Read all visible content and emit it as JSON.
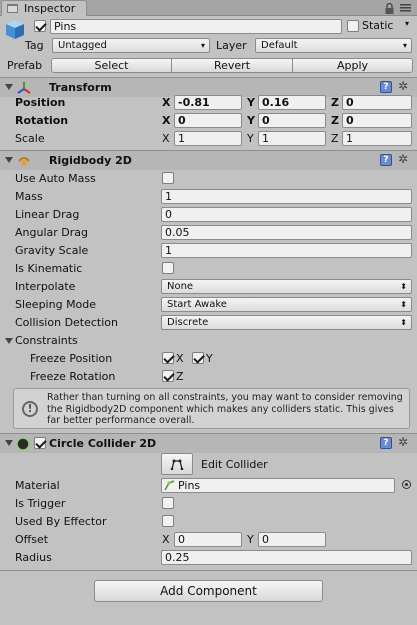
{
  "window": {
    "tab_label": "Inspector"
  },
  "gameobject": {
    "name": "Pins",
    "static_label": "Static",
    "tag_label": "Tag",
    "tag_value": "Untagged",
    "layer_label": "Layer",
    "layer_value": "Default",
    "prefab_label": "Prefab",
    "prefab_buttons": [
      "Select",
      "Revert",
      "Apply"
    ]
  },
  "transform": {
    "title": "Transform",
    "position_label": "Position",
    "position": {
      "x": "-0.81",
      "y": "0.16",
      "z": "0"
    },
    "rotation_label": "Rotation",
    "rotation": {
      "x": "0",
      "y": "0",
      "z": "0"
    },
    "scale_label": "Scale",
    "scale": {
      "x": "1",
      "y": "1",
      "z": "1"
    }
  },
  "axis": {
    "x": "X",
    "y": "Y",
    "z": "Z"
  },
  "rigidbody": {
    "title": "Rigidbody 2D",
    "use_auto_mass_label": "Use Auto Mass",
    "mass_label": "Mass",
    "mass": "1",
    "linear_drag_label": "Linear Drag",
    "linear_drag": "0",
    "angular_drag_label": "Angular Drag",
    "angular_drag": "0.05",
    "gravity_scale_label": "Gravity Scale",
    "gravity_scale": "1",
    "is_kinematic_label": "Is Kinematic",
    "interpolate_label": "Interpolate",
    "interpolate": "None",
    "sleeping_mode_label": "Sleeping Mode",
    "sleeping_mode": "Start Awake",
    "collision_detection_label": "Collision Detection",
    "collision_detection": "Discrete",
    "constraints_label": "Constraints",
    "freeze_position_label": "Freeze Position",
    "freeze_rotation_label": "Freeze Rotation",
    "help_text": "Rather than turning on all constraints, you may want to consider removing the Rigidbody2D component which makes any colliders static. This gives far better performance overall."
  },
  "collider": {
    "title": "Circle Collider 2D",
    "edit_collider_label": "Edit Collider",
    "material_label": "Material",
    "material": "Pins",
    "is_trigger_label": "Is Trigger",
    "used_by_effector_label": "Used By Effector",
    "offset_label": "Offset",
    "offset": {
      "x": "0",
      "y": "0"
    },
    "radius_label": "Radius",
    "radius": "0.25"
  },
  "add_component_label": "Add Component",
  "icons": [
    "inspector-icon",
    "lock-icon",
    "menu-icon",
    "cube-icon",
    "transform-icon",
    "rigidbody-icon",
    "collider-icon",
    "help-icon",
    "gear-icon",
    "info-icon",
    "edit-collider-icon",
    "material-icon",
    "object-picker-icon",
    "foldout-icon"
  ]
}
